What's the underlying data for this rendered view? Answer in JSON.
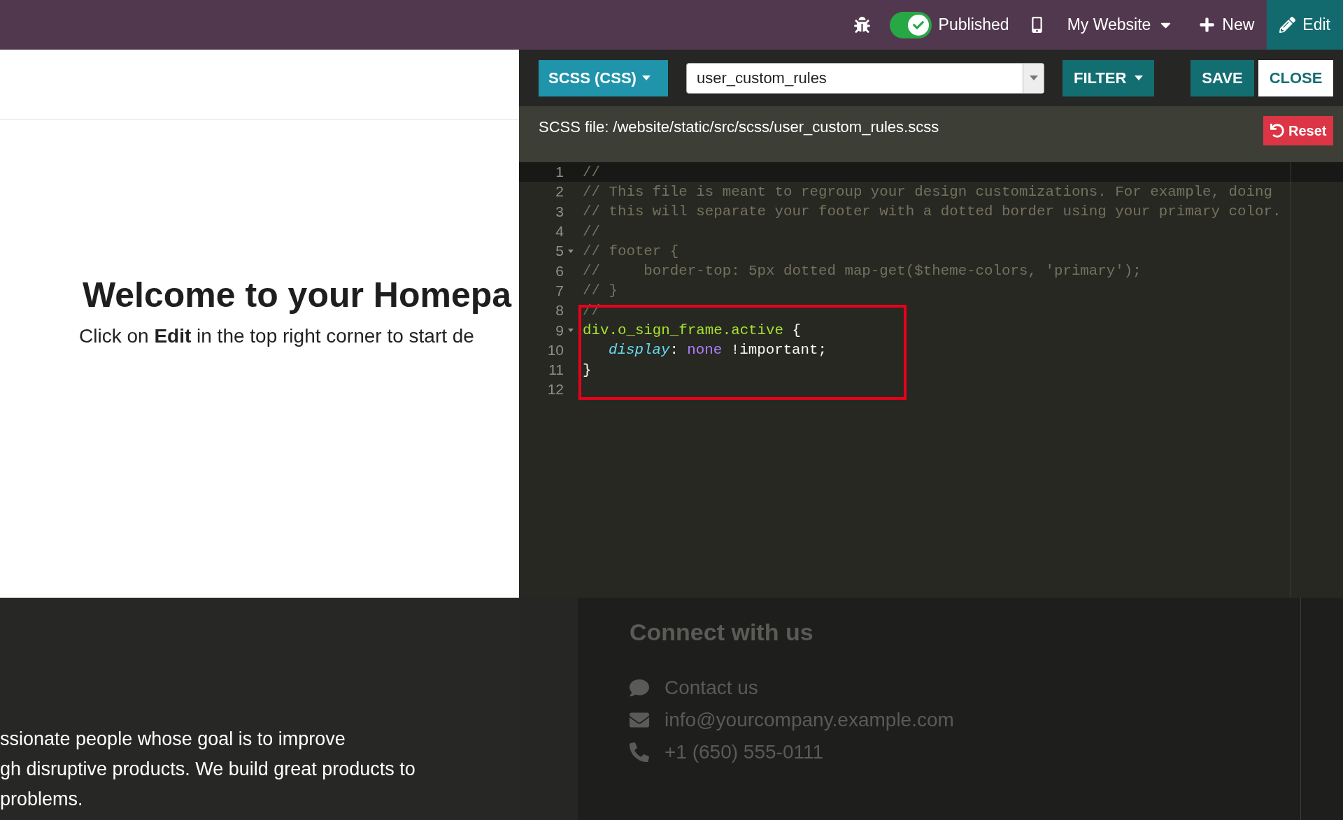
{
  "top_bar": {
    "published_toggle": {
      "label": "Published",
      "on": true
    },
    "website_menu": "My Website",
    "new_button": "New",
    "edit_button": "Edit"
  },
  "page": {
    "heading": "Welcome to your Homepa",
    "intro": "Click on **Edit** in the top right corner to start de",
    "footer_lines": [
      "ssionate people whose goal is to improve",
      "gh disruptive products. We build great products to",
      "problems."
    ]
  },
  "editor": {
    "mode_button": "SCSS (CSS)",
    "file_select": {
      "value": "user_custom_rules"
    },
    "filter_button": "FILTER",
    "save_button": "SAVE",
    "close_button": "CLOSE",
    "file_path": "SCSS file: /website/static/src/scss/user_custom_rules.scss",
    "reset_button": "Reset",
    "lines": [
      {
        "number": "1",
        "foldable": false,
        "active": true,
        "highlighted": false,
        "tokens": [
          {
            "kind": "comment",
            "text": "//"
          }
        ]
      },
      {
        "number": "2",
        "foldable": false,
        "active": false,
        "highlighted": false,
        "tokens": [
          {
            "kind": "comment",
            "text": "// This file is meant to regroup your design customizations. For example, doing"
          }
        ]
      },
      {
        "number": "3",
        "foldable": false,
        "active": false,
        "highlighted": false,
        "tokens": [
          {
            "kind": "comment",
            "text": "// this will separate your footer with a dotted border using your primary color."
          }
        ]
      },
      {
        "number": "4",
        "foldable": false,
        "active": false,
        "highlighted": false,
        "tokens": [
          {
            "kind": "comment",
            "text": "//"
          }
        ]
      },
      {
        "number": "5",
        "foldable": true,
        "active": false,
        "highlighted": false,
        "tokens": [
          {
            "kind": "comment",
            "text": "// footer {"
          }
        ]
      },
      {
        "number": "6",
        "foldable": false,
        "active": false,
        "highlighted": false,
        "tokens": [
          {
            "kind": "comment",
            "text": "//     border-top: 5px dotted map-get($theme-colors, 'primary');"
          }
        ]
      },
      {
        "number": "7",
        "foldable": false,
        "active": false,
        "highlighted": false,
        "tokens": [
          {
            "kind": "comment",
            "text": "// }"
          }
        ]
      },
      {
        "number": "8",
        "foldable": false,
        "active": false,
        "highlighted": false,
        "tokens": [
          {
            "kind": "comment",
            "text": "//"
          }
        ]
      },
      {
        "number": "9",
        "foldable": true,
        "active": false,
        "highlighted": true,
        "tokens": [
          {
            "kind": "selector",
            "text": "div.o_sign_frame.active"
          },
          {
            "kind": "plain",
            "text": " {"
          }
        ]
      },
      {
        "number": "10",
        "foldable": false,
        "active": false,
        "highlighted": true,
        "indented": true,
        "tokens": [
          {
            "kind": "property",
            "text": "display"
          },
          {
            "kind": "plain",
            "text": ": "
          },
          {
            "kind": "value",
            "text": "none"
          },
          {
            "kind": "plain",
            "text": " !important;"
          }
        ]
      },
      {
        "number": "11",
        "foldable": false,
        "active": false,
        "highlighted": true,
        "tokens": [
          {
            "kind": "plain",
            "text": "}"
          }
        ]
      },
      {
        "number": "12",
        "foldable": false,
        "active": false,
        "highlighted": true
      }
    ]
  },
  "footer_behind": {
    "heading": "Connect with us",
    "contacts": [
      {
        "kind": "chat",
        "text": "Contact us"
      },
      {
        "kind": "mail",
        "text": "info@yourcompany.example.com"
      },
      {
        "kind": "phone",
        "text": "+1 (650) 555-0111"
      }
    ]
  }
}
